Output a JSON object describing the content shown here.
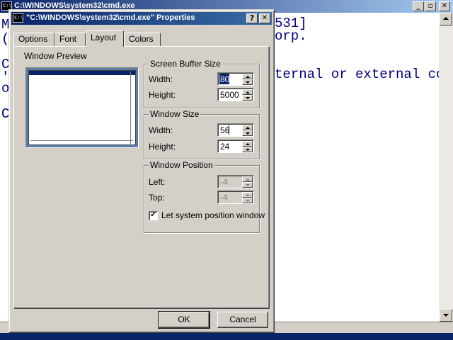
{
  "cmd_window": {
    "title": "C:\\WINDOWS\\system32\\cmd.exe",
    "icon": "cmd-icon",
    "console_lines": [
      {
        "text": "M",
        "row": "line-1"
      },
      {
        "text": "(",
        "row": "line-2"
      },
      {
        "text": "C",
        "row": "line-3"
      },
      {
        "text": "'",
        "row": "line-4"
      },
      {
        "text": "o",
        "row": "line-5"
      },
      {
        "text": "C",
        "row": "line-6"
      }
    ],
    "console_right_lines": [
      {
        "text": "531]"
      },
      {
        "text": "orp."
      },
      {
        "text": "ternal or external co"
      }
    ],
    "text_color": "#000080"
  },
  "dialog": {
    "title": "\"C:\\WINDOWS\\system32\\cmd.exe\" Properties",
    "help_label": "?",
    "close_label": "✕",
    "tabs": [
      {
        "label": "Options",
        "active": false
      },
      {
        "label": "Font",
        "active": false
      },
      {
        "label": "Layout",
        "active": true
      },
      {
        "label": "Colors",
        "active": false
      }
    ],
    "window_preview": {
      "label": "Window Preview"
    },
    "screen_buffer": {
      "group_label": "Screen Buffer Size",
      "width_label": "Width:",
      "width_value": "80",
      "height_label": "Height:",
      "height_value": "5000"
    },
    "window_size": {
      "group_label": "Window Size",
      "width_label": "Width:",
      "width_value": "56",
      "height_label": "Height:",
      "height_value": "24"
    },
    "window_position": {
      "group_label": "Window Position",
      "left_label": "Left:",
      "left_value": "-4",
      "top_label": "Top:",
      "top_value": "-4",
      "system_position_label": "Let system position window",
      "system_position_checked": true,
      "check_glyph": "✔"
    },
    "ok_label": "OK",
    "cancel_label": "Cancel"
  },
  "colors": {
    "title_active": "#0a246a",
    "face": "#d4d0c8",
    "preview_bg": "#5a7eab"
  }
}
